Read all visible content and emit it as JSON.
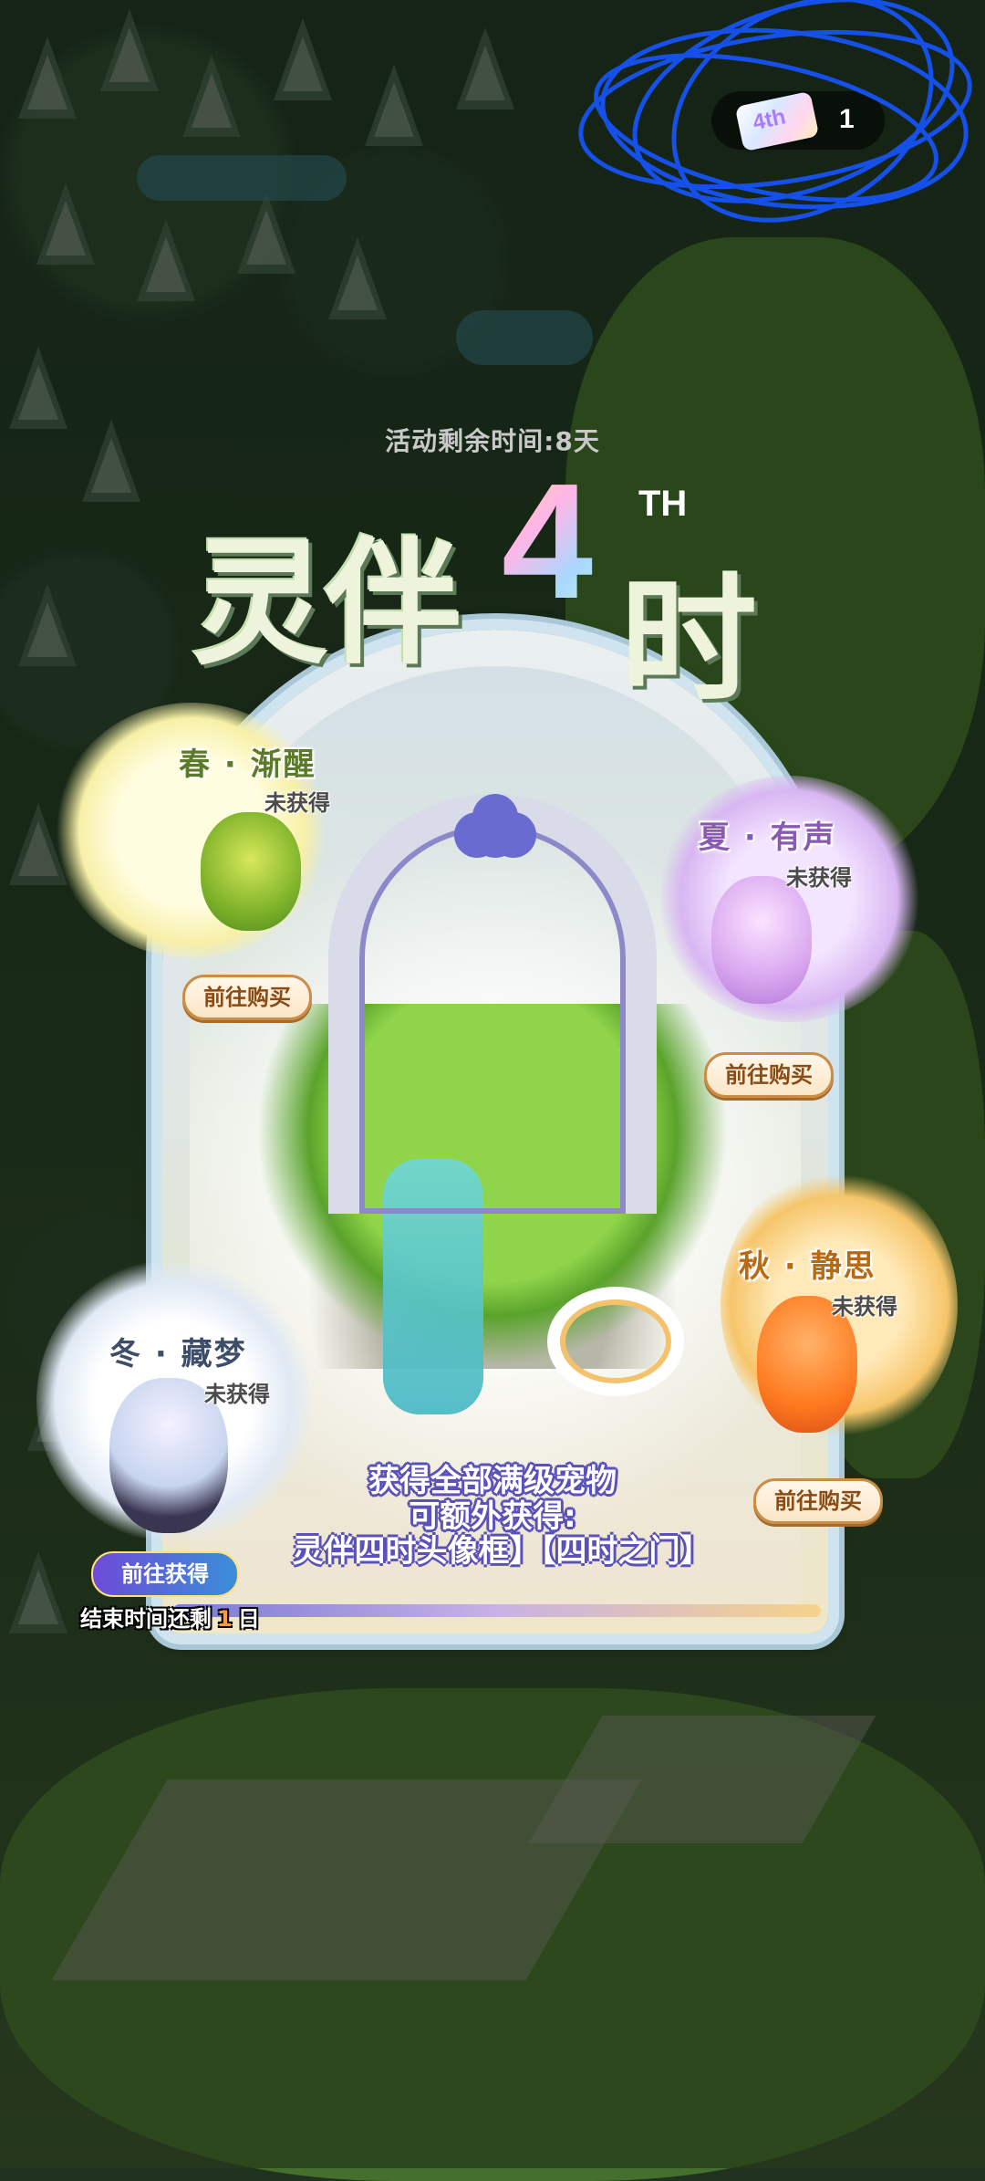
{
  "hud": {
    "ticket_label": "4th",
    "ticket_count": "1"
  },
  "event": {
    "remaining_time": "活动剩余时间:8天",
    "logo": {
      "part1": "灵伴",
      "four": "4",
      "th": "TH",
      "part2": "时"
    },
    "pets": [
      {
        "name": "春 · 渐醒",
        "status": "未获得",
        "button": "前往购买"
      },
      {
        "name": "夏 · 有声",
        "status": "未获得",
        "button": "前往购买"
      },
      {
        "name": "秋 · 静思",
        "status": "未获得",
        "button": "前往购买"
      },
      {
        "name": "冬 · 藏梦",
        "status": "未获得",
        "button": "前往获得"
      }
    ],
    "reward_line1": "获得全部满级宠物",
    "reward_line2": "可额外获得:",
    "reward_items": "灵伴四时头像框】【四时之门】",
    "end_prefix": "结束时间还剩",
    "end_number": "1",
    "end_suffix": "日"
  },
  "colors": {
    "accent_purple": "#5a52b8",
    "button_border": "#c98d47",
    "countdown_number": "#ff9a3c"
  }
}
